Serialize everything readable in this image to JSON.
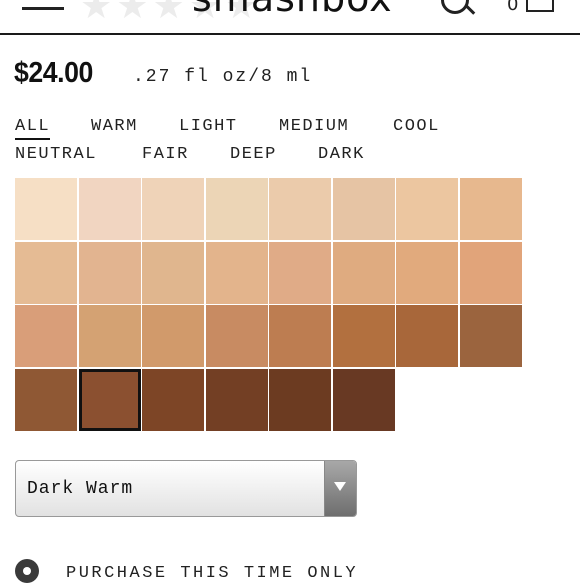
{
  "header": {
    "logo_text": "smashbox",
    "stars": "★★★★★",
    "cart_count": "0"
  },
  "product": {
    "price": "$24.00",
    "size": ".27 fl oz/8 ml"
  },
  "filters": [
    {
      "label": "ALL",
      "active": true
    },
    {
      "label": "WARM",
      "active": false
    },
    {
      "label": "LIGHT",
      "active": false
    },
    {
      "label": "MEDIUM",
      "active": false
    },
    {
      "label": "COOL",
      "active": false
    },
    {
      "label": "NEUTRAL",
      "active": false
    },
    {
      "label": "FAIR",
      "active": false
    },
    {
      "label": "DEEP",
      "active": false
    },
    {
      "label": "DARK",
      "active": false
    }
  ],
  "swatches": [
    [
      "#f6dfc5",
      "#f1d5c1",
      "#efd3b8",
      "#ecd5b6",
      "#ebcbab",
      "#e6c4a4",
      "#ecc6a0",
      "#e7b88e"
    ],
    [
      "#e5bb94",
      "#e2b490",
      "#e0b68e",
      "#e3b48c",
      "#e0ab87",
      "#dfab80",
      "#e1aa7d",
      "#e1a47a"
    ],
    [
      "#d99e79",
      "#d4a273",
      "#d19a6b",
      "#c88b62",
      "#bd7d51",
      "#b2703f",
      "#a8673a",
      "#9b643e"
    ],
    [
      "#8f5834",
      "#8b5030",
      "#7d4526",
      "#733f24",
      "#6c3b21",
      "#683923"
    ]
  ],
  "selected_swatch": {
    "row": 3,
    "col": 1
  },
  "shade_select": {
    "value": "Dark Warm"
  },
  "purchase_option": {
    "label": "PURCHASE THIS TIME ONLY",
    "selected": true
  }
}
